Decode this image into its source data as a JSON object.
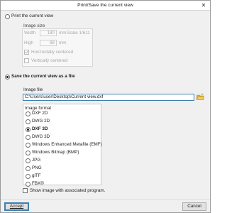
{
  "window": {
    "title": "Print/Save the current view",
    "close_glyph": "✕"
  },
  "print_option": {
    "label": "Print the current view",
    "selected": false,
    "image_size": {
      "title": "Image size",
      "width_label": "Width",
      "width_value": "180",
      "width_unit": "mm",
      "scale_label": "Scale 1/611",
      "high_label": "High",
      "high_value": "88",
      "high_unit": "mm",
      "h_centered_label": "Horizontally centered",
      "h_centered_checked": true,
      "v_centered_label": "Vertically centered",
      "v_centered_checked": false
    }
  },
  "save_option": {
    "label": "Save the current view as a file",
    "selected": true,
    "image_file_title": "Image file",
    "file_path": "C:\\Users\\user\\Desktop\\Current view.dxf",
    "folder_icon": "folder-open-icon",
    "image_format_title": "Image format",
    "formats": [
      {
        "label": "DXF 2D",
        "selected": false
      },
      {
        "label": "DWG 2D",
        "selected": false
      },
      {
        "label": "DXF 3D",
        "selected": true
      },
      {
        "label": "DWG 3D",
        "selected": false
      },
      {
        "label": "Windows Enhanced Metafile (EMF)",
        "selected": false
      },
      {
        "label": "Windows Bitmap (BMP)",
        "selected": false
      },
      {
        "label": "JPG",
        "selected": false
      },
      {
        "label": "PNG",
        "selected": false
      },
      {
        "label": "glTF",
        "selected": false
      },
      {
        "label": "FBX®",
        "selected": false
      }
    ],
    "show_image_label": "Show image with associated program.",
    "show_image_checked": false
  },
  "footer": {
    "accept_label": "Accept",
    "cancel_label": "Cancel"
  },
  "colors": {
    "accent": "#3c7fb1",
    "folder": "#e8b33a"
  }
}
